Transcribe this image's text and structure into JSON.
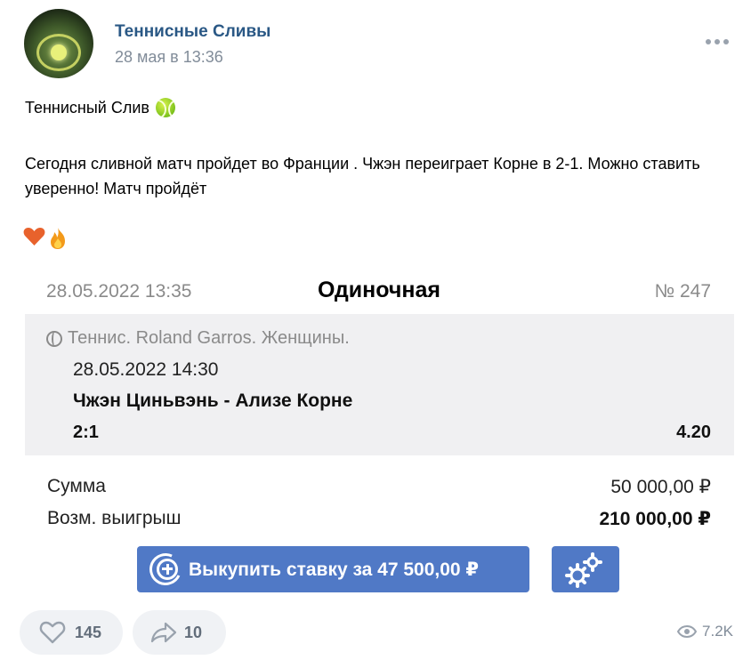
{
  "post": {
    "author": "Теннисные Сливы",
    "date": "28 мая в 13:36",
    "title": "Теннисный Слив",
    "body": "Сегодня сливной матч пройдет во Франции . Чжэн переиграет Корне в 2-1. Можно ставить уверенно! Матч пройдёт",
    "emojis": [
      "heart",
      "fire"
    ]
  },
  "bet": {
    "created": "28.05.2022 13:35",
    "type": "Одиночная",
    "number": "№ 247",
    "sport": "Теннис. Roland Garros. Женщины.",
    "match_date": "28.05.2022 14:30",
    "match": "Чжэн Циньвэнь - Ализе Корне",
    "outcome": "2:1",
    "odds": "4.20",
    "sum_label": "Сумма",
    "sum_value": "50 000,00 ₽",
    "win_label": "Возм. выигрыш",
    "win_value": "210 000,00 ₽",
    "buyback_label": "Выкупить ставку за 47 500,00 ₽"
  },
  "footer": {
    "likes": "145",
    "shares": "10",
    "views": "7.2K"
  },
  "colors": {
    "link": "#2a5885",
    "button": "#5079c6",
    "muted": "#818c99"
  }
}
